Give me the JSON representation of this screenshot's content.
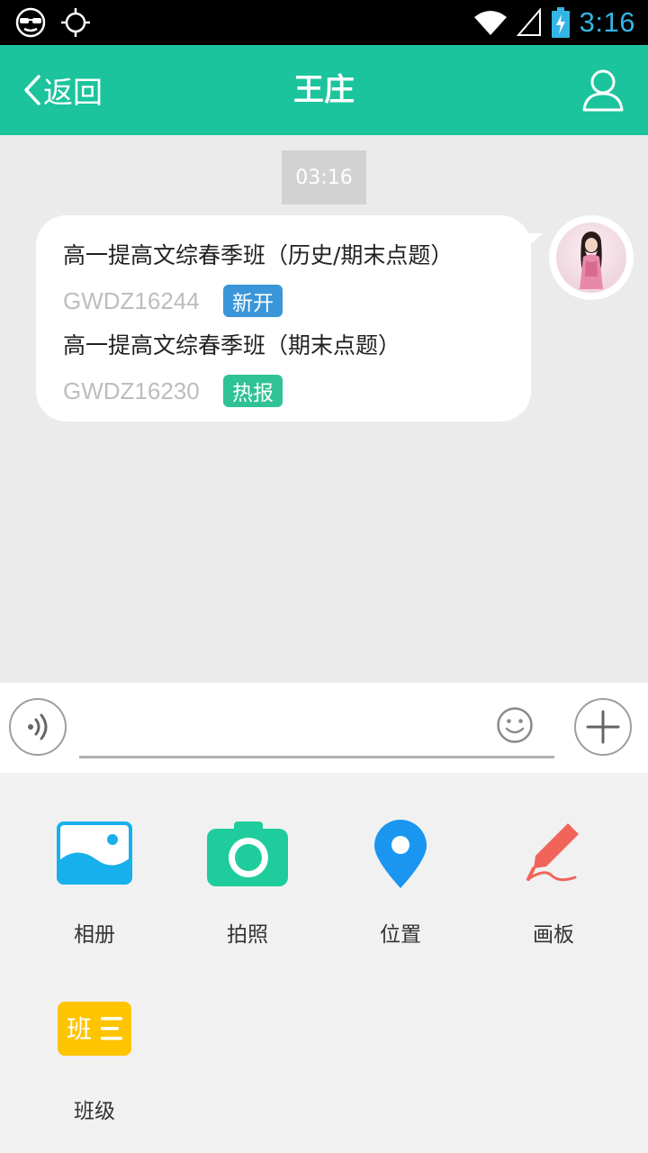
{
  "status_bar": {
    "time": "3:16",
    "icons": [
      "incognito-icon",
      "gps-icon",
      "wifi-icon",
      "signal-icon",
      "battery-charging-icon"
    ]
  },
  "header": {
    "back_label": "返回",
    "title": "王庄",
    "profile_icon": "person-icon"
  },
  "chat": {
    "timestamp": "03:16",
    "message": {
      "courses": [
        {
          "name": "高一提高文综春季班（历史/期末点题）",
          "code": "GWDZ16244",
          "tag": "新开",
          "tag_color": "#3a96d8"
        },
        {
          "name": "高一提高文综春季班（期末点题）",
          "code": "GWDZ16230",
          "tag": "热报",
          "tag_color": "#2fc294"
        }
      ]
    }
  },
  "input_bar": {
    "value": "",
    "placeholder": "",
    "voice_icon": "voice-icon",
    "emoji_icon": "emoji-icon",
    "plus_icon": "plus-icon"
  },
  "tools": [
    {
      "label": "相册",
      "icon": "album-icon",
      "color": "#17b0ec"
    },
    {
      "label": "拍照",
      "icon": "camera-icon",
      "color": "#1fcc9c"
    },
    {
      "label": "位置",
      "icon": "location-icon",
      "color": "#1a96f0"
    },
    {
      "label": "画板",
      "icon": "pen-icon",
      "color": "#f0645a"
    },
    {
      "label": "班级",
      "icon": "class-icon",
      "icon_text": "班",
      "color": "#ffc400"
    }
  ],
  "colors": {
    "primary": "#1bc49c",
    "chat_background": "#ebebeb",
    "panel_background": "#f1f1f1"
  }
}
